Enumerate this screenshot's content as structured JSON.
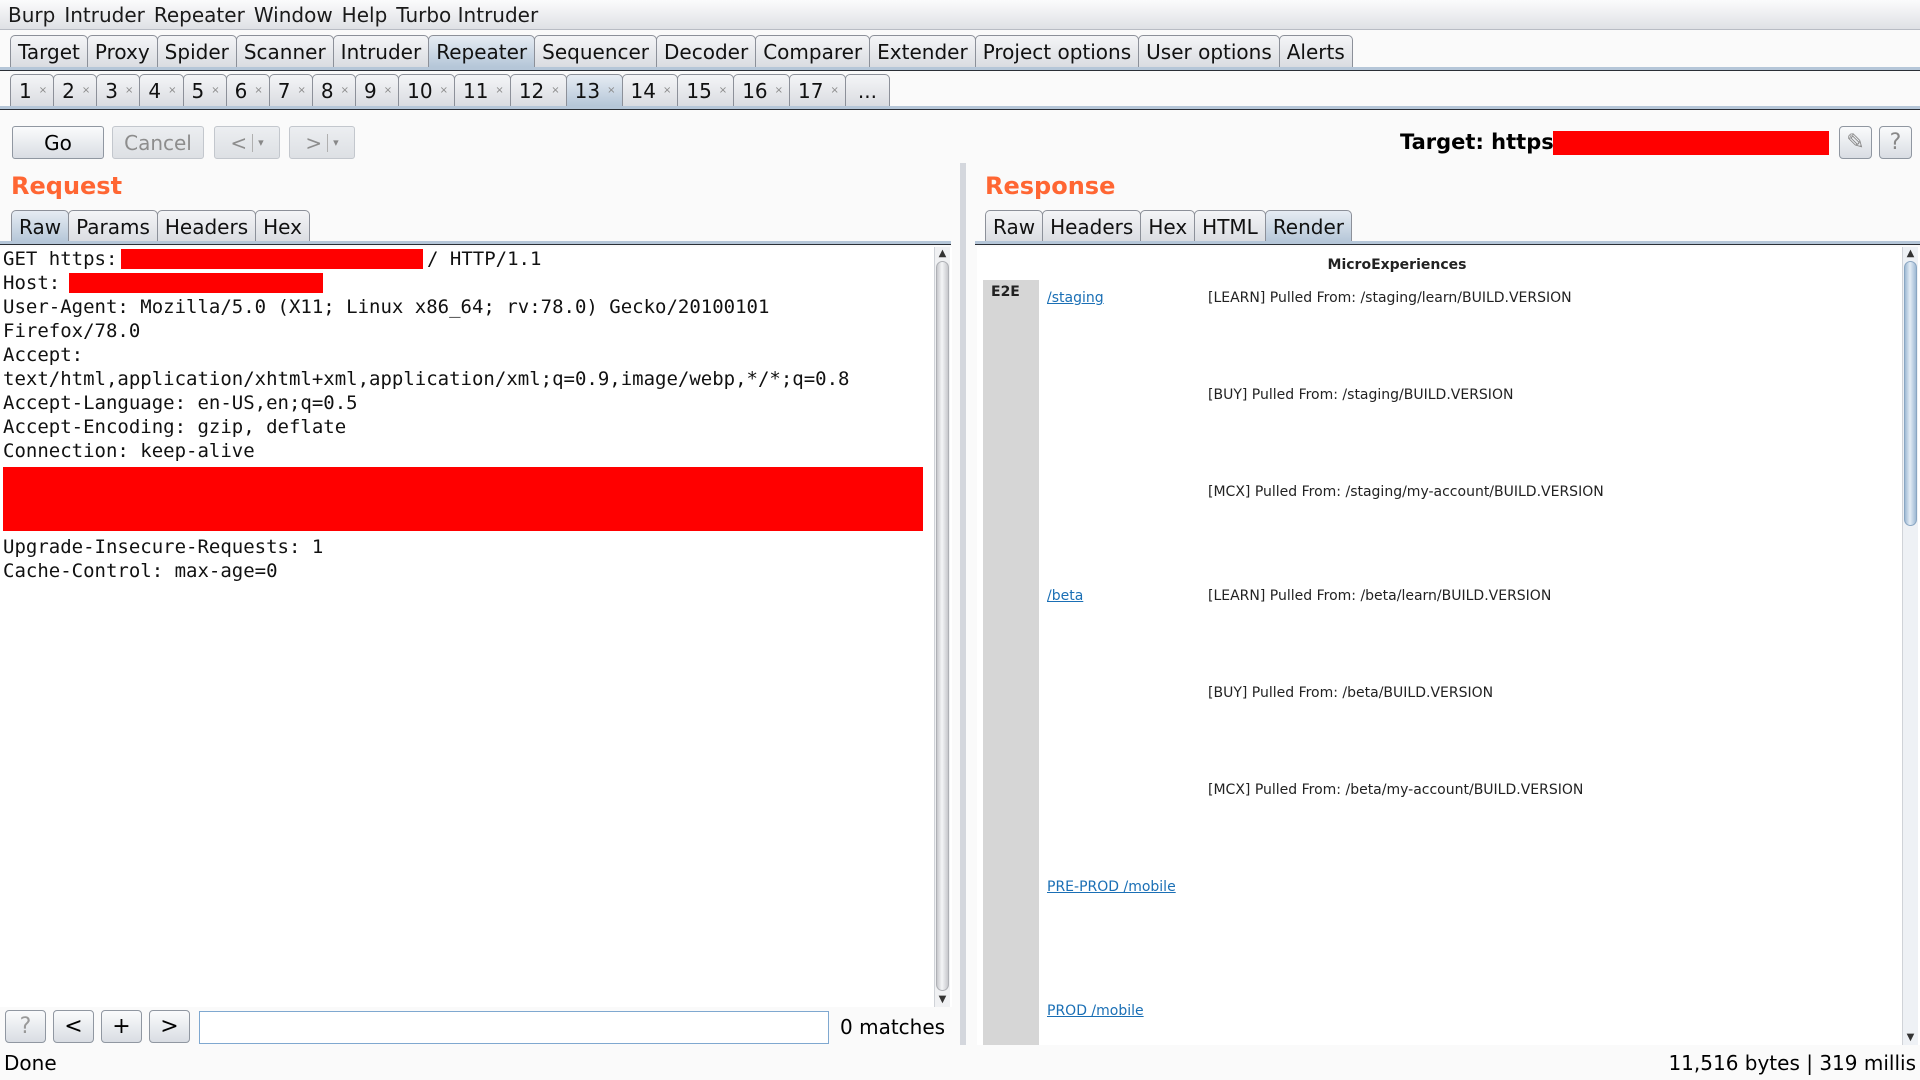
{
  "menubar": [
    "Burp",
    "Intruder",
    "Repeater",
    "Window",
    "Help",
    "Turbo Intruder"
  ],
  "main_tabs": [
    {
      "label": "Target",
      "active": false
    },
    {
      "label": "Proxy",
      "active": false
    },
    {
      "label": "Spider",
      "active": false
    },
    {
      "label": "Scanner",
      "active": false
    },
    {
      "label": "Intruder",
      "active": false
    },
    {
      "label": "Repeater",
      "active": true
    },
    {
      "label": "Sequencer",
      "active": false
    },
    {
      "label": "Decoder",
      "active": false
    },
    {
      "label": "Comparer",
      "active": false
    },
    {
      "label": "Extender",
      "active": false
    },
    {
      "label": "Project options",
      "active": false
    },
    {
      "label": "User options",
      "active": false
    },
    {
      "label": "Alerts",
      "active": false
    }
  ],
  "repeater_tabs": [
    {
      "label": "1",
      "close": "×"
    },
    {
      "label": "2",
      "close": "×"
    },
    {
      "label": "3",
      "close": "×"
    },
    {
      "label": "4",
      "close": "×"
    },
    {
      "label": "5",
      "close": "×"
    },
    {
      "label": "6",
      "close": "×"
    },
    {
      "label": "7",
      "close": "×"
    },
    {
      "label": "8",
      "close": "×"
    },
    {
      "label": "9",
      "close": "×"
    },
    {
      "label": "10",
      "close": "×"
    },
    {
      "label": "11",
      "close": "×"
    },
    {
      "label": "12",
      "close": "×"
    },
    {
      "label": "13",
      "close": "×",
      "active": true
    },
    {
      "label": "14",
      "close": "×"
    },
    {
      "label": "15",
      "close": "×"
    },
    {
      "label": "16",
      "close": "×"
    },
    {
      "label": "17",
      "close": "×"
    },
    {
      "label": "...",
      "close": ""
    }
  ],
  "toolbar": {
    "go_label": "Go",
    "cancel_label": "Cancel",
    "back_label": "<",
    "forward_label": ">",
    "dropdown_glyph": "▾",
    "target_label": "Target: https",
    "target_redacted": true,
    "edit_icon": "✎",
    "help_icon": "?"
  },
  "request": {
    "heading": "Request",
    "tabs": [
      {
        "label": "Raw",
        "active": true
      },
      {
        "label": "Params",
        "active": false
      },
      {
        "label": "Headers",
        "active": false
      },
      {
        "label": "Hex",
        "active": false
      }
    ],
    "lines": [
      {
        "pre": "GET https:",
        "redacted": true,
        "post": "/ HTTP/1.1"
      },
      {
        "pre": "Host:",
        "redacted": true,
        "post": ""
      },
      {
        "pre": "User-Agent: Mozilla/5.0 (X11; Linux x86_64; rv:78.0) Gecko/20100101",
        "redacted": false,
        "post": ""
      },
      {
        "pre": "Firefox/78.0",
        "redacted": false,
        "post": ""
      },
      {
        "pre": "Accept:",
        "redacted": false,
        "post": ""
      },
      {
        "pre": "text/html,application/xhtml+xml,application/xml;q=0.9,image/webp,*/*;q=0.8",
        "redacted": false,
        "post": ""
      },
      {
        "pre": "Accept-Language: en-US,en;q=0.5",
        "redacted": false,
        "post": ""
      },
      {
        "pre": "Accept-Encoding: gzip, deflate",
        "redacted": false,
        "post": ""
      },
      {
        "pre": "Connection: keep-alive",
        "redacted": false,
        "post": ""
      },
      {
        "pre": "",
        "redacted": true,
        "post": ""
      },
      {
        "pre": "",
        "redacted": true,
        "post": ""
      },
      {
        "pre": "",
        "redacted": true,
        "post": ""
      },
      {
        "pre": "Upgrade-Insecure-Requests: 1",
        "redacted": false,
        "post": ""
      },
      {
        "pre": "Cache-Control: max-age=0",
        "redacted": false,
        "post": ""
      }
    ]
  },
  "search": {
    "help_label": "?",
    "prev_label": "<",
    "add_label": "+",
    "next_label": ">",
    "value": "",
    "placeholder": "",
    "matches": "0 matches"
  },
  "response": {
    "heading": "Response",
    "tabs": [
      {
        "label": "Raw",
        "active": false
      },
      {
        "label": "Headers",
        "active": false
      },
      {
        "label": "Hex",
        "active": false
      },
      {
        "label": "HTML",
        "active": false
      },
      {
        "label": "Render",
        "active": true
      }
    ],
    "render": {
      "title": "MicroExperiences",
      "env_label": "E2E",
      "groups": [
        {
          "link": "/staging",
          "items": [
            "[LEARN] Pulled From: /staging/learn/BUILD.VERSION",
            "[BUY] Pulled From: /staging/BUILD.VERSION",
            "[MCX] Pulled From: /staging/my-account/BUILD.VERSION"
          ]
        },
        {
          "link": "/beta",
          "items": [
            "[LEARN] Pulled From: /beta/learn/BUILD.VERSION",
            "[BUY] Pulled From: /beta/BUILD.VERSION",
            "[MCX] Pulled From: /beta/my-account/BUILD.VERSION"
          ]
        },
        {
          "link": "PRE-PROD /mobile",
          "items": []
        },
        {
          "link": "PROD /mobile",
          "items": []
        }
      ]
    }
  },
  "status": {
    "left": "Done",
    "right": "11,516 bytes | 319 millis"
  },
  "colors": {
    "heading_accent": "#ff6633",
    "redaction": "#ff0000",
    "link": "#1a6fb5",
    "active_tab": "#b5c6d8"
  }
}
